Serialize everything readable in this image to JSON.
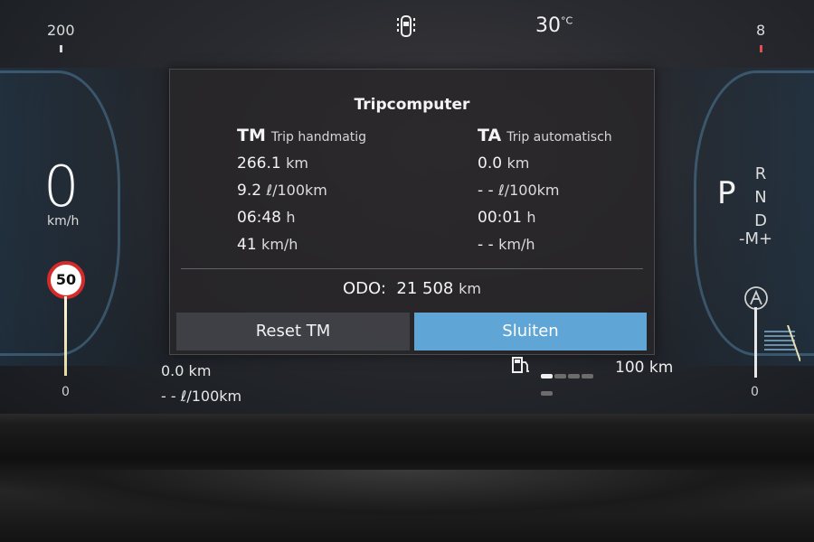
{
  "header": {
    "left_scale": "200",
    "right_scale": "8",
    "temperature_value": "30",
    "temperature_unit": "°C"
  },
  "speedometer": {
    "speed": "0",
    "unit": "km/h",
    "speed_limit": "50",
    "scale_min": "0"
  },
  "tachometer": {
    "scale_min": "0"
  },
  "gear": {
    "selected": "P",
    "options": [
      "R",
      "N",
      "D"
    ],
    "manual": "-M+"
  },
  "tripcomputer": {
    "title": "Tripcomputer",
    "tm": {
      "abbr": "TM",
      "label": "Trip handmatig",
      "distance": "266.1",
      "distance_unit": "km",
      "consumption": "9.2",
      "consumption_unit": "ℓ/100km",
      "time": "06:48",
      "time_unit": "h",
      "avg_speed": "41",
      "avg_speed_unit": "km/h"
    },
    "ta": {
      "abbr": "TA",
      "label": "Trip automatisch",
      "distance": "0.0",
      "distance_unit": "km",
      "consumption": "- -",
      "consumption_unit": "ℓ/100km",
      "time": "00:01",
      "time_unit": "h",
      "avg_speed": "- -",
      "avg_speed_unit": "km/h"
    },
    "odo_label": "ODO:",
    "odo_value": "21 508",
    "odo_unit": "km",
    "reset_label": "Reset TM",
    "close_label": "Sluiten"
  },
  "bottom_info": {
    "trip_distance": "0.0",
    "trip_distance_unit": "km",
    "trip_consumption": "- -",
    "trip_consumption_unit": "ℓ/100km",
    "range": "100",
    "range_unit": "km",
    "fuel_level_fraction": 0.2
  },
  "colors": {
    "accent_button": "#5fa6d6",
    "speed_limit_ring": "#d52b2b"
  }
}
